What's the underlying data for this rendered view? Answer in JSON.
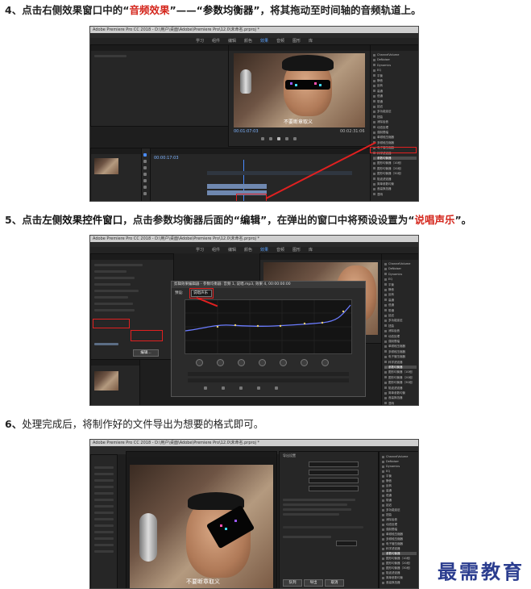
{
  "steps": [
    {
      "number": "4、",
      "prefix": "点击右侧效果窗口中的",
      "q1_open": "“",
      "q1_text": "音频效果",
      "q1_close": "”",
      "dash": "——",
      "q2_open": "“",
      "q2_text": "参数均衡器",
      "q2_close": "”",
      "suffix": "，将其拖动至时间轴的音频轨道上。"
    },
    {
      "number": "5、",
      "prefix": "点击",
      "bold": "左侧效果控件窗口",
      "middle": "，点击参数均衡器后面的",
      "q1_open": "“",
      "q1_text": "编辑",
      "q1_close": "”",
      "middle2": "，在弹出的窗口中将预设设置为",
      "q2_open": "“",
      "q2_text": "说唱声乐",
      "q2_close": "”",
      "end": "。"
    },
    {
      "number": "6、",
      "text": "处理完成后，将制作好的文件导出为想要的格式即可。"
    }
  ],
  "screenshots": {
    "s1": {
      "titlebar": "Adobe Premiere Pro CC 2018 - D:\\用户\\桌面\\Adobe\\Premiere Pro\\12.0\\未命名.prproj *",
      "workspaces": [
        "学习",
        "组件",
        "编辑",
        "颜色",
        "效果",
        "音频",
        "图形",
        "库"
      ],
      "active_workspace": "效果",
      "subtitle": "不要断章取义",
      "timecode_left": "00:01:07:03",
      "timecode_right": "00:02:31:06",
      "sequence_timecode": "00:00:17:03",
      "effects_list": [
        "ChannelVolume",
        "DeNoiser",
        "Dynamics",
        "EQ",
        "平衡",
        "静音",
        "反转",
        "高通",
        "低通",
        "带通",
        "延迟",
        "多功能延迟",
        "扭曲",
        "消除齿音",
        "动态处理",
        "强制限幅",
        "单频段压缩器",
        "多频段压缩器",
        "电子管压缩器",
        "科学滤波器",
        "参数均衡器",
        "图形均衡器（10段）",
        "图形均衡器（20段）",
        "图形均衡器（30段）",
        "陷波滤波器",
        "简单参数均衡",
        "音高换挡器",
        "混响"
      ],
      "selected_effect": "参数均衡器"
    },
    "s2": {
      "titlebar": "Adobe Premiere Pro CC 2018 - D:\\用户\\桌面\\Adobe\\Premiere Pro\\12.0\\未命名.prproj *",
      "dialog_title": "剪辑效果编辑器 - 参数均衡器: 音频 1, 说唱.mp3, 效果 4, 00:00:00:00",
      "preset_label": "预设:",
      "preset_value": "说唱声乐",
      "edit_button": "编辑..."
    },
    "s3": {
      "titlebar": "Adobe Premiere Pro CC 2018 - D:\\用户\\桌面\\Adobe\\Premiere Pro\\12.0\\未命名.prproj *",
      "subtitle": "不要断章取义",
      "panel_title": "导出设置",
      "export_button": "导出",
      "queue_button": "队列",
      "cancel_button": "取消"
    }
  },
  "watermark": "最需教育",
  "colors": {
    "highlight": "#d4261c",
    "annotation": "#e02020",
    "watermark": "#2b3d8f"
  }
}
